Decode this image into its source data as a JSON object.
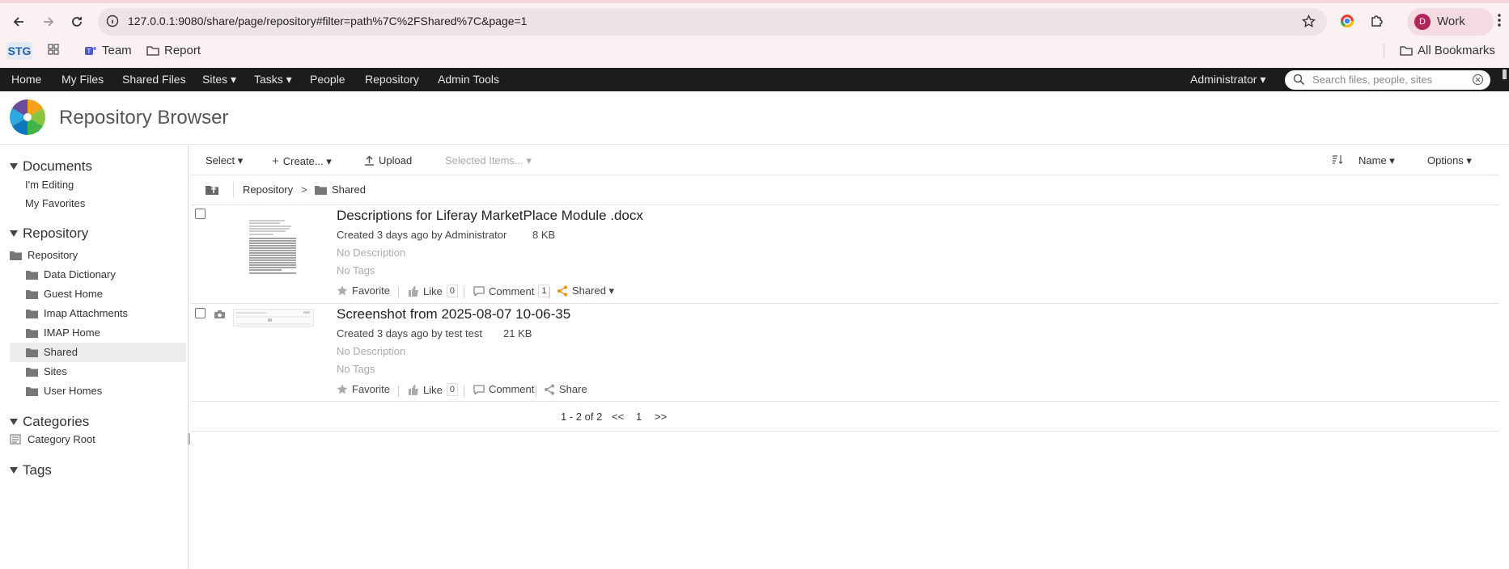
{
  "browser": {
    "url": "127.0.0.1:9080/share/page/repository#filter=path%7C%2FShared%7C&page=1",
    "profile_initial": "D",
    "profile_label": "Work",
    "bookmarks": {
      "stg": "STG",
      "team": "Team",
      "report": "Report",
      "all": "All Bookmarks"
    }
  },
  "nav": {
    "home": "Home",
    "my_files": "My Files",
    "shared_files": "Shared Files",
    "sites": "Sites ▾",
    "tasks": "Tasks ▾",
    "people": "People",
    "repository": "Repository",
    "admin_tools": "Admin Tools",
    "user": "Administrator ▾",
    "search_placeholder": "Search files, people, sites"
  },
  "page": {
    "title": "Repository Browser"
  },
  "sidebar": {
    "documents": {
      "heading": "Documents",
      "items": [
        "I'm Editing",
        "My Favorites"
      ]
    },
    "repository": {
      "heading": "Repository",
      "root": "Repository",
      "folders": [
        "Data Dictionary",
        "Guest Home",
        "Imap Attachments",
        "IMAP Home",
        "Shared",
        "Sites",
        "User Homes"
      ],
      "selected": "Shared"
    },
    "categories": {
      "heading": "Categories",
      "root": "Category Root"
    },
    "tags": {
      "heading": "Tags"
    }
  },
  "toolbar": {
    "select": "Select ▾",
    "create": "Create... ▾",
    "upload": "Upload",
    "selected_items": "Selected Items... ▾",
    "sort_name": "Name ▾",
    "options": "Options ▾"
  },
  "path": {
    "root": "Repository",
    "separator": ">",
    "current": "Shared"
  },
  "rows": [
    {
      "title": "Descriptions for Liferay MarketPlace Module .docx",
      "meta": "Created 3 days ago by Administrator",
      "size": "8 KB",
      "description": "No Description",
      "tags": "No Tags",
      "favorite": "Favorite",
      "like": "Like",
      "like_count": "0",
      "comment": "Comment",
      "comment_count": "1",
      "share": "Shared ▾"
    },
    {
      "title": "Screenshot from 2025-08-07 10-06-35",
      "meta": "Created 3 days ago by test test",
      "size": "21 KB",
      "description": "No Description",
      "tags": "No Tags",
      "favorite": "Favorite",
      "like": "Like",
      "like_count": "0",
      "comment": "Comment",
      "share": "Share"
    }
  ],
  "pager": {
    "summary": "1 - 2 of 2",
    "prev": "<<",
    "page": "1",
    "next": ">>"
  },
  "colors": {
    "nav_bg": "#1c1c1c",
    "share_accent": "#e6930c",
    "chrome_bg": "#fbf1f3"
  }
}
